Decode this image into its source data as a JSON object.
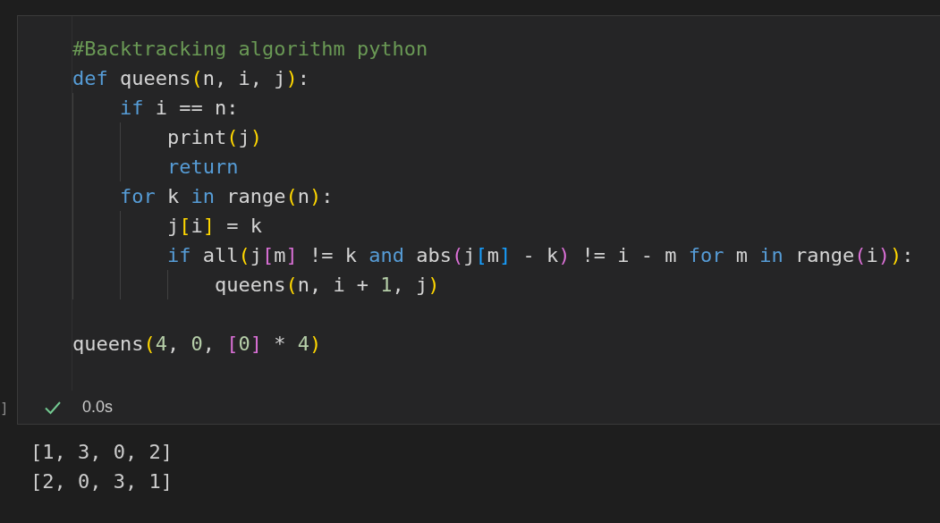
{
  "cell": {
    "code": [
      {
        "kind": "code",
        "tokens": [
          {
            "kind": "comment",
            "text": "#Backtracking algorithm python"
          }
        ]
      },
      {
        "kind": "code",
        "tokens": [
          {
            "kind": "keyword",
            "text": "def"
          },
          {
            "kind": "plain",
            "text": " queens"
          },
          {
            "kind": "paren1",
            "text": "("
          },
          {
            "kind": "plain",
            "text": "n, i, j"
          },
          {
            "kind": "paren1",
            "text": ")"
          },
          {
            "kind": "plain",
            "text": ":"
          }
        ],
        "children": [
          {
            "kind": "code",
            "tokens": [
              {
                "kind": "keyword",
                "text": "if"
              },
              {
                "kind": "plain",
                "text": " i == n:"
              }
            ],
            "children": [
              {
                "kind": "code",
                "tokens": [
                  {
                    "kind": "plain",
                    "text": "print"
                  },
                  {
                    "kind": "paren1",
                    "text": "("
                  },
                  {
                    "kind": "plain",
                    "text": "j"
                  },
                  {
                    "kind": "paren1",
                    "text": ")"
                  }
                ]
              },
              {
                "kind": "code",
                "tokens": [
                  {
                    "kind": "keyword",
                    "text": "return"
                  }
                ]
              }
            ]
          },
          {
            "kind": "code",
            "tokens": [
              {
                "kind": "keyword",
                "text": "for"
              },
              {
                "kind": "plain",
                "text": " k "
              },
              {
                "kind": "keyword",
                "text": "in"
              },
              {
                "kind": "plain",
                "text": " range"
              },
              {
                "kind": "paren1",
                "text": "("
              },
              {
                "kind": "plain",
                "text": "n"
              },
              {
                "kind": "paren1",
                "text": ")"
              },
              {
                "kind": "plain",
                "text": ":"
              }
            ],
            "children": [
              {
                "kind": "code",
                "tokens": [
                  {
                    "kind": "plain",
                    "text": "j"
                  },
                  {
                    "kind": "paren1",
                    "text": "["
                  },
                  {
                    "kind": "plain",
                    "text": "i"
                  },
                  {
                    "kind": "paren1",
                    "text": "]"
                  },
                  {
                    "kind": "plain",
                    "text": " = k"
                  }
                ]
              },
              {
                "kind": "code",
                "tokens": [
                  {
                    "kind": "keyword",
                    "text": "if"
                  },
                  {
                    "kind": "plain",
                    "text": " all"
                  },
                  {
                    "kind": "paren1",
                    "text": "("
                  },
                  {
                    "kind": "plain",
                    "text": "j"
                  },
                  {
                    "kind": "paren2",
                    "text": "["
                  },
                  {
                    "kind": "plain",
                    "text": "m"
                  },
                  {
                    "kind": "paren2",
                    "text": "]"
                  },
                  {
                    "kind": "plain",
                    "text": " != k "
                  },
                  {
                    "kind": "keyword",
                    "text": "and"
                  },
                  {
                    "kind": "plain",
                    "text": " abs"
                  },
                  {
                    "kind": "paren2",
                    "text": "("
                  },
                  {
                    "kind": "plain",
                    "text": "j"
                  },
                  {
                    "kind": "paren3",
                    "text": "["
                  },
                  {
                    "kind": "plain",
                    "text": "m"
                  },
                  {
                    "kind": "paren3",
                    "text": "]"
                  },
                  {
                    "kind": "plain",
                    "text": " - k"
                  },
                  {
                    "kind": "paren2",
                    "text": ")"
                  },
                  {
                    "kind": "plain",
                    "text": " != i - m "
                  },
                  {
                    "kind": "keyword",
                    "text": "for"
                  },
                  {
                    "kind": "plain",
                    "text": " m "
                  },
                  {
                    "kind": "keyword",
                    "text": "in"
                  },
                  {
                    "kind": "plain",
                    "text": " range"
                  },
                  {
                    "kind": "paren2",
                    "text": "("
                  },
                  {
                    "kind": "plain",
                    "text": "i"
                  },
                  {
                    "kind": "paren2",
                    "text": ")"
                  },
                  {
                    "kind": "paren1",
                    "text": ")"
                  },
                  {
                    "kind": "plain",
                    "text": ":"
                  }
                ],
                "children": [
                  {
                    "kind": "code",
                    "tokens": [
                      {
                        "kind": "plain",
                        "text": "queens"
                      },
                      {
                        "kind": "paren1",
                        "text": "("
                      },
                      {
                        "kind": "plain",
                        "text": "n, i + "
                      },
                      {
                        "kind": "number",
                        "text": "1"
                      },
                      {
                        "kind": "plain",
                        "text": ", j"
                      },
                      {
                        "kind": "paren1",
                        "text": ")"
                      }
                    ]
                  }
                ]
              }
            ]
          }
        ]
      },
      {
        "kind": "blank"
      },
      {
        "kind": "code",
        "tokens": [
          {
            "kind": "plain",
            "text": "queens"
          },
          {
            "kind": "paren1",
            "text": "("
          },
          {
            "kind": "number",
            "text": "4"
          },
          {
            "kind": "plain",
            "text": ", "
          },
          {
            "kind": "number",
            "text": "0"
          },
          {
            "kind": "plain",
            "text": ", "
          },
          {
            "kind": "paren2",
            "text": "["
          },
          {
            "kind": "number",
            "text": "0"
          },
          {
            "kind": "paren2",
            "text": "]"
          },
          {
            "kind": "plain",
            "text": " * "
          },
          {
            "kind": "number",
            "text": "4"
          },
          {
            "kind": "paren1",
            "text": ")"
          }
        ]
      }
    ]
  },
  "execution_count": "]",
  "status": {
    "succeeded": true,
    "duration": "0.0s"
  },
  "output": [
    "[1, 3, 0, 2]",
    "[2, 0, 3, 1]"
  ]
}
